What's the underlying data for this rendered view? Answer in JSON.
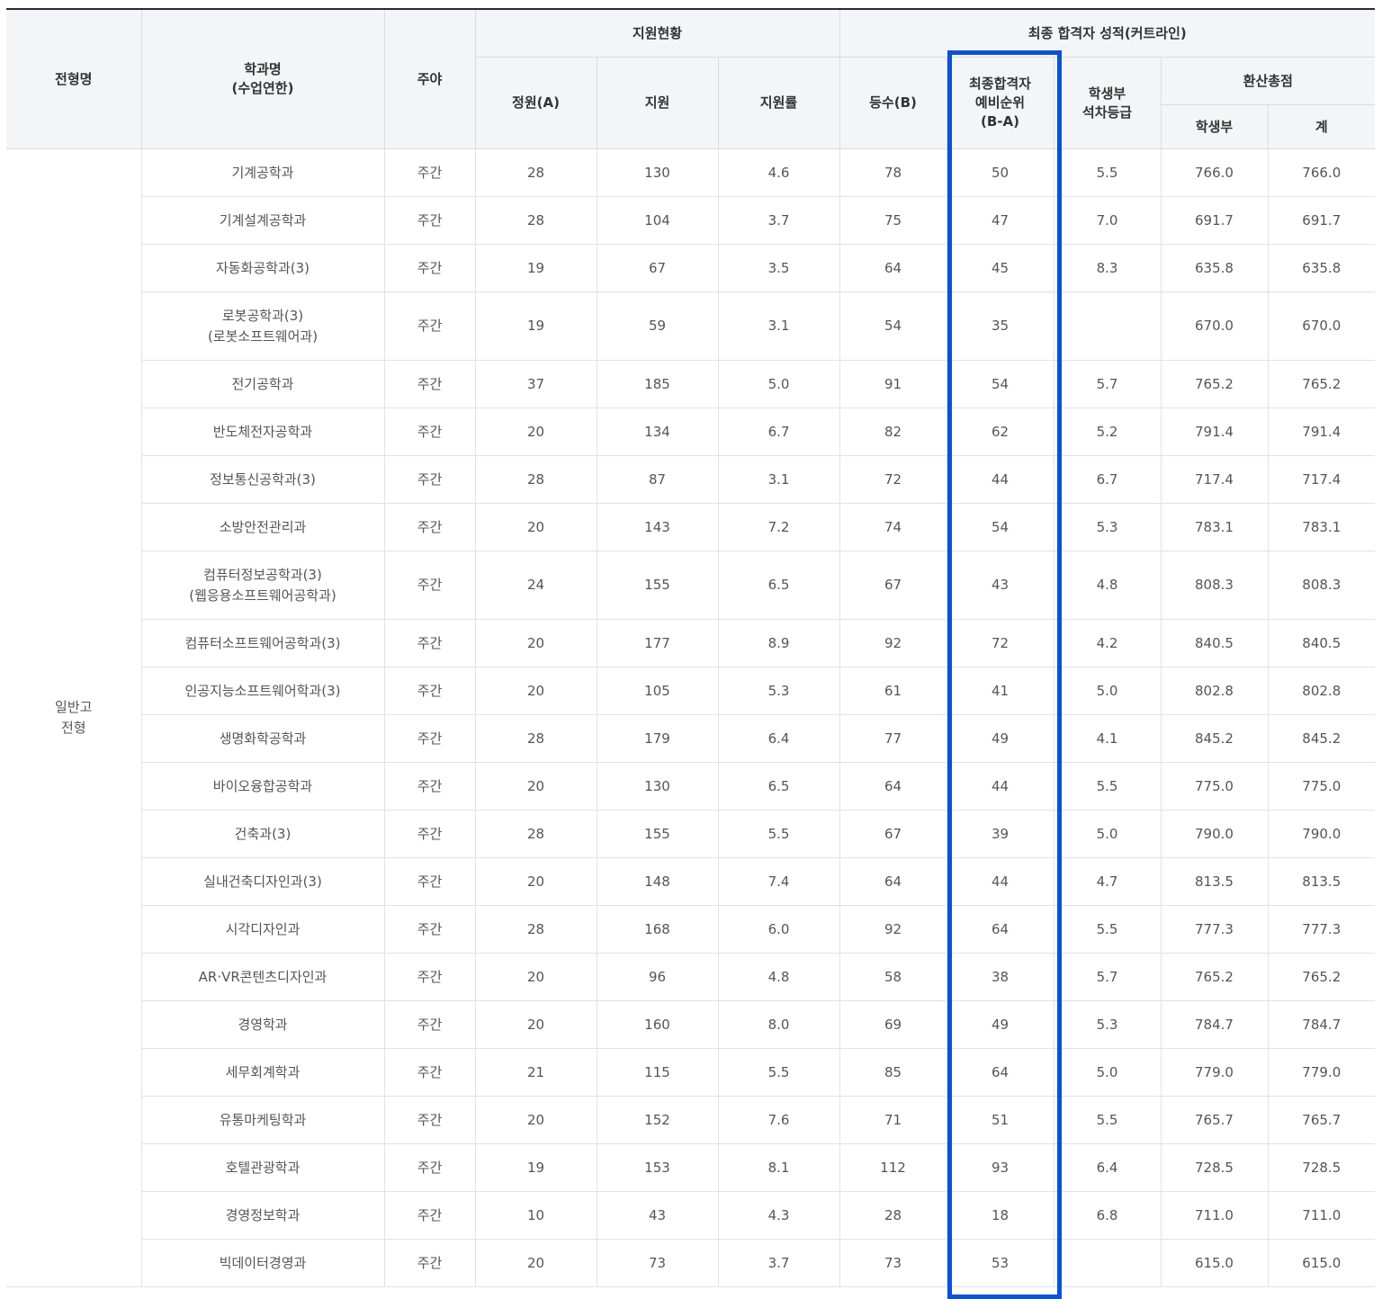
{
  "colors": {
    "highlight": "#0a52d6",
    "header_bg": "#f4f5f6",
    "top_border": "#222b3a"
  },
  "header": {
    "type": "전형명",
    "dept": "학과명",
    "dept_sub": "(수업연한)",
    "shift": "주야",
    "apply_group": "지원현황",
    "final_group": "최종 합격자 성적(커트라인)",
    "quota": "정원(A)",
    "applicants": "지원",
    "ratio": "지원률",
    "rank": "등수(B)",
    "reserve_l1": "최종합격자",
    "reserve_l2": "예비순위",
    "reserve_l3": "(B-A)",
    "grade_l1": "학생부",
    "grade_l2": "석차등급",
    "score_group": "환산총점",
    "score_record": "학생부",
    "score_total": "계"
  },
  "group": {
    "line1": "일반고",
    "line2": "전형"
  },
  "rows": [
    {
      "dept": "기계공학과",
      "dept2": "",
      "shift": "주간",
      "quota": "28",
      "applicants": "130",
      "ratio": "4.6",
      "rank": "78",
      "reserve": "50",
      "grade": "5.5",
      "record": "766.0",
      "total": "766.0"
    },
    {
      "dept": "기계설계공학과",
      "dept2": "",
      "shift": "주간",
      "quota": "28",
      "applicants": "104",
      "ratio": "3.7",
      "rank": "75",
      "reserve": "47",
      "grade": "7.0",
      "record": "691.7",
      "total": "691.7"
    },
    {
      "dept": "자동화공학과(3)",
      "dept2": "",
      "shift": "주간",
      "quota": "19",
      "applicants": "67",
      "ratio": "3.5",
      "rank": "64",
      "reserve": "45",
      "grade": "8.3",
      "record": "635.8",
      "total": "635.8"
    },
    {
      "dept": "로봇공학과(3)",
      "dept2": "(로봇소프트웨어과)",
      "shift": "주간",
      "quota": "19",
      "applicants": "59",
      "ratio": "3.1",
      "rank": "54",
      "reserve": "35",
      "grade": "",
      "record": "670.0",
      "total": "670.0"
    },
    {
      "dept": "전기공학과",
      "dept2": "",
      "shift": "주간",
      "quota": "37",
      "applicants": "185",
      "ratio": "5.0",
      "rank": "91",
      "reserve": "54",
      "grade": "5.7",
      "record": "765.2",
      "total": "765.2"
    },
    {
      "dept": "반도체전자공학과",
      "dept2": "",
      "shift": "주간",
      "quota": "20",
      "applicants": "134",
      "ratio": "6.7",
      "rank": "82",
      "reserve": "62",
      "grade": "5.2",
      "record": "791.4",
      "total": "791.4"
    },
    {
      "dept": "정보통신공학과(3)",
      "dept2": "",
      "shift": "주간",
      "quota": "28",
      "applicants": "87",
      "ratio": "3.1",
      "rank": "72",
      "reserve": "44",
      "grade": "6.7",
      "record": "717.4",
      "total": "717.4"
    },
    {
      "dept": "소방안전관리과",
      "dept2": "",
      "shift": "주간",
      "quota": "20",
      "applicants": "143",
      "ratio": "7.2",
      "rank": "74",
      "reserve": "54",
      "grade": "5.3",
      "record": "783.1",
      "total": "783.1"
    },
    {
      "dept": "컴퓨터정보공학과(3)",
      "dept2": "(웹응용소프트웨어공학과)",
      "shift": "주간",
      "quota": "24",
      "applicants": "155",
      "ratio": "6.5",
      "rank": "67",
      "reserve": "43",
      "grade": "4.8",
      "record": "808.3",
      "total": "808.3"
    },
    {
      "dept": "컴퓨터소프트웨어공학과(3)",
      "dept2": "",
      "shift": "주간",
      "quota": "20",
      "applicants": "177",
      "ratio": "8.9",
      "rank": "92",
      "reserve": "72",
      "grade": "4.2",
      "record": "840.5",
      "total": "840.5"
    },
    {
      "dept": "인공지능소프트웨어학과(3)",
      "dept2": "",
      "shift": "주간",
      "quota": "20",
      "applicants": "105",
      "ratio": "5.3",
      "rank": "61",
      "reserve": "41",
      "grade": "5.0",
      "record": "802.8",
      "total": "802.8"
    },
    {
      "dept": "생명화학공학과",
      "dept2": "",
      "shift": "주간",
      "quota": "28",
      "applicants": "179",
      "ratio": "6.4",
      "rank": "77",
      "reserve": "49",
      "grade": "4.1",
      "record": "845.2",
      "total": "845.2"
    },
    {
      "dept": "바이오융합공학과",
      "dept2": "",
      "shift": "주간",
      "quota": "20",
      "applicants": "130",
      "ratio": "6.5",
      "rank": "64",
      "reserve": "44",
      "grade": "5.5",
      "record": "775.0",
      "total": "775.0"
    },
    {
      "dept": "건축과(3)",
      "dept2": "",
      "shift": "주간",
      "quota": "28",
      "applicants": "155",
      "ratio": "5.5",
      "rank": "67",
      "reserve": "39",
      "grade": "5.0",
      "record": "790.0",
      "total": "790.0"
    },
    {
      "dept": "실내건축디자인과(3)",
      "dept2": "",
      "shift": "주간",
      "quota": "20",
      "applicants": "148",
      "ratio": "7.4",
      "rank": "64",
      "reserve": "44",
      "grade": "4.7",
      "record": "813.5",
      "total": "813.5"
    },
    {
      "dept": "시각디자인과",
      "dept2": "",
      "shift": "주간",
      "quota": "28",
      "applicants": "168",
      "ratio": "6.0",
      "rank": "92",
      "reserve": "64",
      "grade": "5.5",
      "record": "777.3",
      "total": "777.3"
    },
    {
      "dept": "AR·VR콘텐츠디자인과",
      "dept2": "",
      "shift": "주간",
      "quota": "20",
      "applicants": "96",
      "ratio": "4.8",
      "rank": "58",
      "reserve": "38",
      "grade": "5.7",
      "record": "765.2",
      "total": "765.2"
    },
    {
      "dept": "경영학과",
      "dept2": "",
      "shift": "주간",
      "quota": "20",
      "applicants": "160",
      "ratio": "8.0",
      "rank": "69",
      "reserve": "49",
      "grade": "5.3",
      "record": "784.7",
      "total": "784.7"
    },
    {
      "dept": "세무회계학과",
      "dept2": "",
      "shift": "주간",
      "quota": "21",
      "applicants": "115",
      "ratio": "5.5",
      "rank": "85",
      "reserve": "64",
      "grade": "5.0",
      "record": "779.0",
      "total": "779.0"
    },
    {
      "dept": "유통마케팅학과",
      "dept2": "",
      "shift": "주간",
      "quota": "20",
      "applicants": "152",
      "ratio": "7.6",
      "rank": "71",
      "reserve": "51",
      "grade": "5.5",
      "record": "765.7",
      "total": "765.7"
    },
    {
      "dept": "호텔관광학과",
      "dept2": "",
      "shift": "주간",
      "quota": "19",
      "applicants": "153",
      "ratio": "8.1",
      "rank": "112",
      "reserve": "93",
      "grade": "6.4",
      "record": "728.5",
      "total": "728.5"
    },
    {
      "dept": "경영정보학과",
      "dept2": "",
      "shift": "주간",
      "quota": "10",
      "applicants": "43",
      "ratio": "4.3",
      "rank": "28",
      "reserve": "18",
      "grade": "6.8",
      "record": "711.0",
      "total": "711.0"
    },
    {
      "dept": "빅데이터경영과",
      "dept2": "",
      "shift": "주간",
      "quota": "20",
      "applicants": "73",
      "ratio": "3.7",
      "rank": "73",
      "reserve": "53",
      "grade": "",
      "record": "615.0",
      "total": "615.0"
    }
  ]
}
